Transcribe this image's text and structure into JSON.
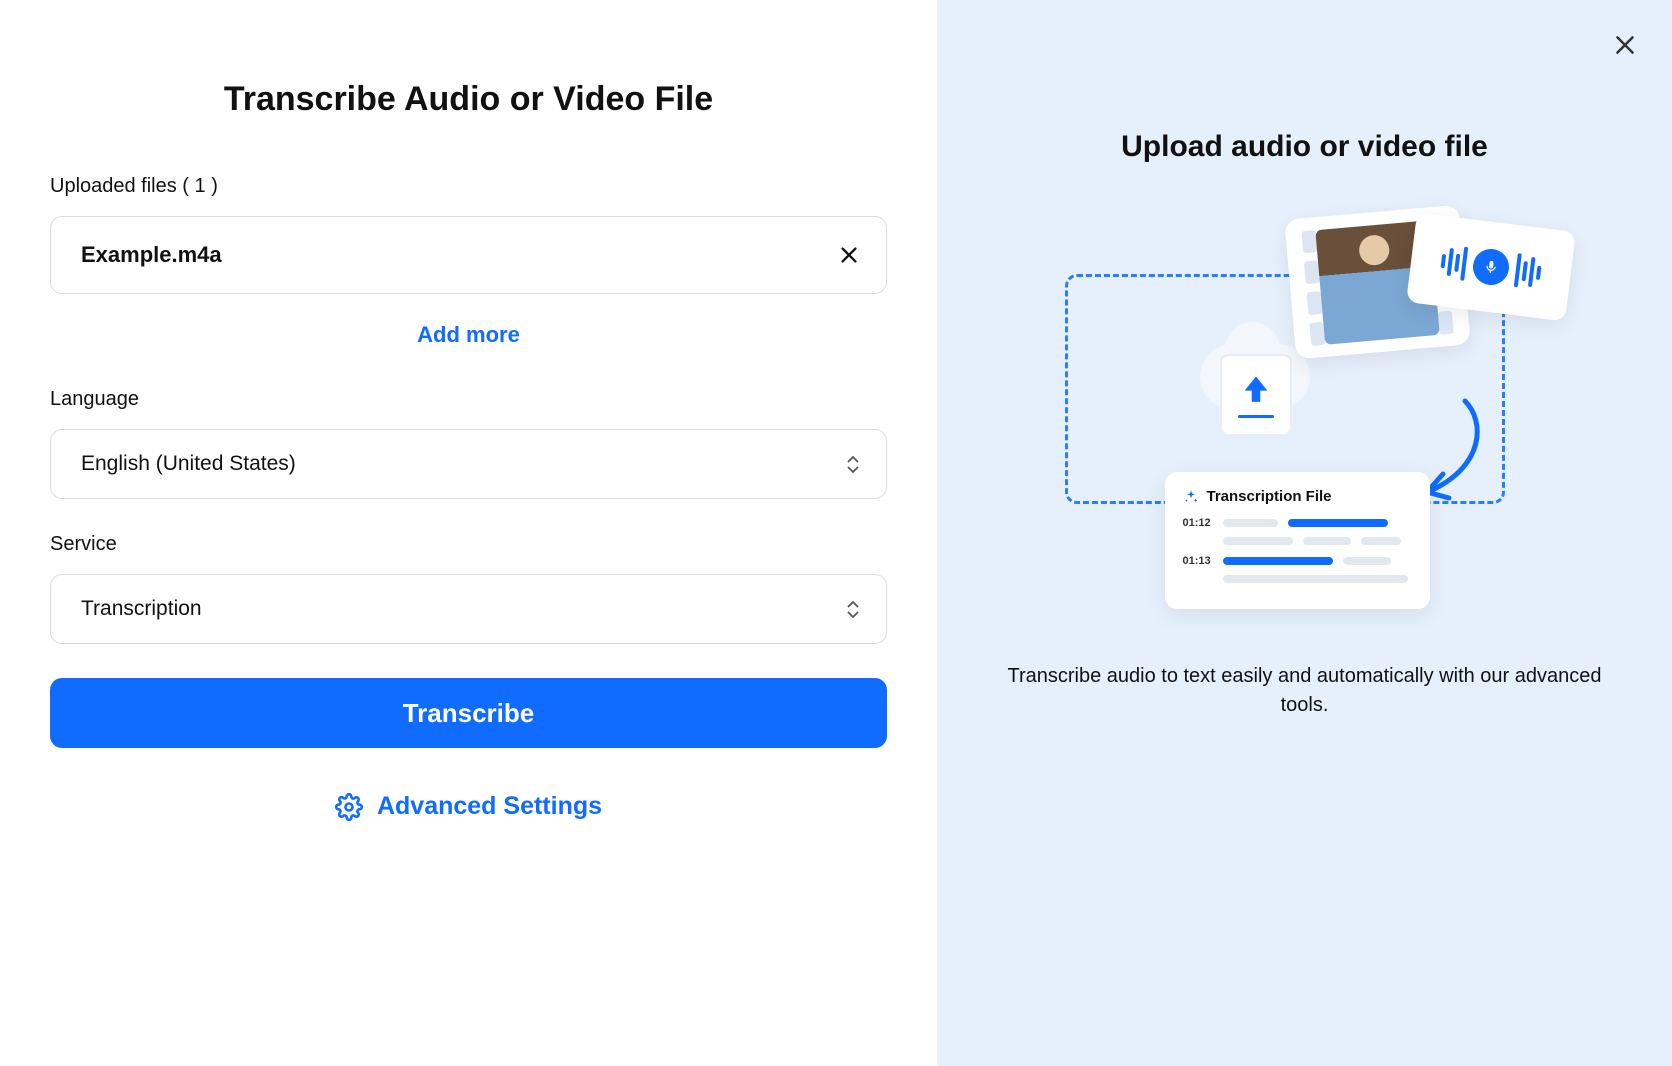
{
  "main": {
    "title": "Transcribe Audio or Video File",
    "uploaded_label": "Uploaded files ( 1 )",
    "file_name": "Example.m4a",
    "add_more": "Add more",
    "language_label": "Language",
    "language_value": "English (United States)",
    "service_label": "Service",
    "service_value": "Transcription",
    "transcribe_button": "Transcribe",
    "advanced_settings": "Advanced Settings"
  },
  "promo": {
    "title": "Upload audio or video file",
    "card_title": "Transcription File",
    "ts1": "01:12",
    "ts2": "01:13",
    "description": "Transcribe audio to text easily and automatically with our advanced tools."
  }
}
